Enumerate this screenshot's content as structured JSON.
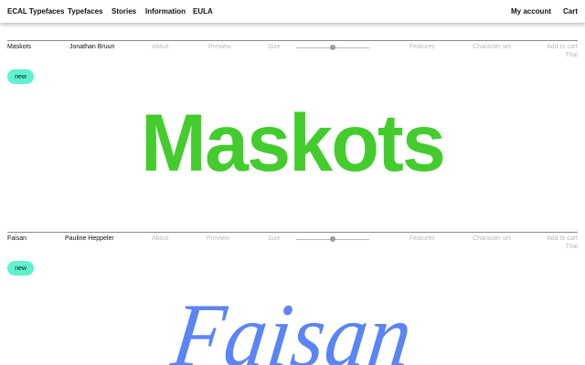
{
  "nav": {
    "brand": "ECAL Typefaces",
    "items": [
      "Typefaces",
      "Stories",
      "Information",
      "EULA"
    ],
    "account": "My account",
    "cart": "Cart"
  },
  "colors": {
    "badge_bg": "#5ef2cf",
    "maskots_green": "#44cc2e",
    "faisan_blue": "#5b84f5"
  },
  "fonts": [
    {
      "name": "Maskots",
      "designer": "Jonathan Bruun",
      "about": "About",
      "preview": "Preview",
      "size_label": "Size",
      "size_value": 0.5,
      "features": "Features",
      "charset": "Character set",
      "add_to_cart": "Add to cart",
      "trial": "Trial",
      "badge": "new",
      "specimen": "Maskots"
    },
    {
      "name": "Faisan",
      "designer": "Pauline Heppeler",
      "about": "About",
      "preview": "Preview",
      "size_label": "Size",
      "size_value": 0.5,
      "features": "Features",
      "charset": "Character set",
      "add_to_cart": "Add to cart",
      "trial": "Trial",
      "badge": "new",
      "specimen": "Faisan"
    }
  ]
}
